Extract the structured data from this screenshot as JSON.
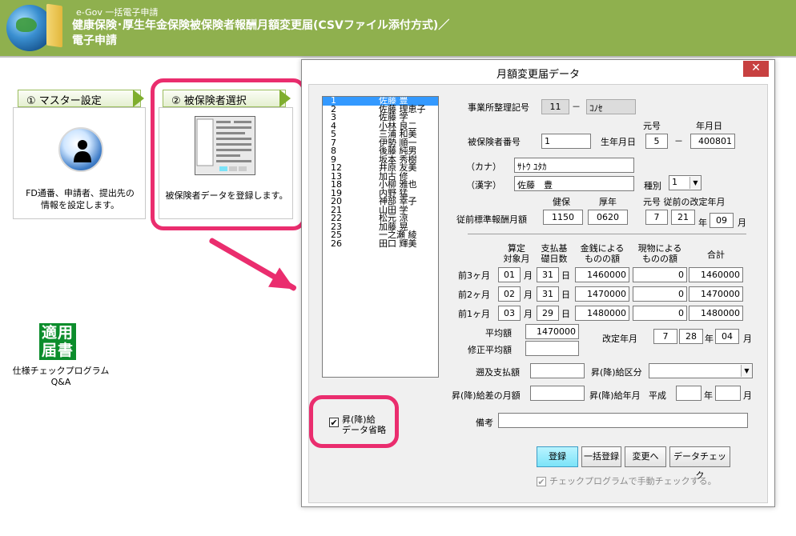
{
  "header": {
    "app_small": "e-Gov 一括電子申請",
    "title_line1": "健康保険･厚生年金保険被保険者報酬月額変更届(CSVファイル添付方式)／",
    "title_line2": "電子申請"
  },
  "steps": [
    {
      "tab": "① マスター設定",
      "text1": "FD通番、申請者、提出先の",
      "text2": "情報を設定します。"
    },
    {
      "tab": "② 被保険者選択",
      "text1": "被保険者データを登録します。"
    }
  ],
  "left_icon": {
    "glyph": "適用届書",
    "label1": "仕様チェックプログラム",
    "label2": "Q&A"
  },
  "dialog": {
    "title": "月額変更届データ",
    "close": "✕",
    "list": [
      {
        "no": "1",
        "name": "佐藤 豊"
      },
      {
        "no": "2",
        "name": "佐藤 理恵子"
      },
      {
        "no": "3",
        "name": "佐藤 学"
      },
      {
        "no": "4",
        "name": "小林 良二"
      },
      {
        "no": "5",
        "name": "三浦 和美"
      },
      {
        "no": "7",
        "name": "伊勢 順一"
      },
      {
        "no": "8",
        "name": "後藤 純男"
      },
      {
        "no": "9",
        "name": "坂本 秀樹"
      },
      {
        "no": "12",
        "name": "井原 友美"
      },
      {
        "no": "13",
        "name": "加古 修"
      },
      {
        "no": "18",
        "name": "小柳 雅也"
      },
      {
        "no": "19",
        "name": "内野 猛"
      },
      {
        "no": "20",
        "name": "神部 幸子"
      },
      {
        "no": "21",
        "name": "山田 学"
      },
      {
        "no": "22",
        "name": "松元 涼"
      },
      {
        "no": "23",
        "name": "加藤 晃"
      },
      {
        "no": "25",
        "name": "一之瀬 綾"
      },
      {
        "no": "26",
        "name": "田口 輝美"
      }
    ],
    "office_code_label": "事業所整理記号",
    "office_code1": "11",
    "dash": "－",
    "office_code2": "ｺﾉｾ",
    "insured_no_label": "被保険者番号",
    "insured_no": "1",
    "birth_label": "生年月日",
    "era_label": "元号",
    "ymd_label": "年月日",
    "birth_era": "5",
    "birth_date": "400801",
    "kana_label": "（カナ）",
    "kana_value": "ｻﾄｳ ﾕﾀｶ",
    "kanji_label": "（漢字）",
    "kanji_value": "佐藤　豊",
    "type_label": "種別",
    "type_value": "1",
    "prev_std_label": "従前標準報酬月額",
    "health_label": "健保",
    "pension_label": "厚年",
    "prev_rev_label": "元号 従前の改定年月",
    "prev_health": "1150",
    "prev_pension": "0620",
    "prev_era": "7",
    "prev_year": "21",
    "year_char": "年",
    "prev_month": "09",
    "month_char": "月",
    "col_target": "算定\n対象月",
    "col_days": "支払基\n礎日数",
    "col_cash": "金銭による\nものの額",
    "col_kind": "現物による\nものの額",
    "col_total": "合計",
    "day_char": "日",
    "rows": [
      {
        "label": "前3ヶ月",
        "month": "01",
        "days": "31",
        "cash": "1460000",
        "kind": "0",
        "total": "1460000"
      },
      {
        "label": "前2ヶ月",
        "month": "02",
        "days": "31",
        "cash": "1470000",
        "kind": "0",
        "total": "1470000"
      },
      {
        "label": "前1ヶ月",
        "month": "03",
        "days": "29",
        "cash": "1480000",
        "kind": "0",
        "total": "1480000"
      }
    ],
    "avg_label": "平均額",
    "avg_value": "1470000",
    "mod_avg_label": "修正平均額",
    "mod_avg_value": "",
    "rev_label": "改定年月",
    "rev_era": "7",
    "rev_year": "28",
    "rev_month": "04",
    "retro_label": "遡及支払額",
    "retro_value": "",
    "updown_label": "昇(降)給区分",
    "updown_value": "",
    "diff_label": "昇(降)給差の月額",
    "diff_value": "",
    "updown_ym_label": "昇(降)給年月",
    "heisei": "平成",
    "updown_year": "",
    "updown_month": "",
    "note_label": "備考",
    "note_value": "",
    "omit_check": "✔",
    "omit_line1": "昇(降)給",
    "omit_line2": "データ省略",
    "buttons": {
      "register": "登録",
      "bulk": "一括登録",
      "change": "変更へ",
      "check": "データチェック"
    },
    "manual_check": "チェックプログラムで手動チェックする。"
  },
  "colors": {
    "header": "#8fb04e",
    "highlight": "#ea2d6e",
    "selection": "#3399ff"
  }
}
